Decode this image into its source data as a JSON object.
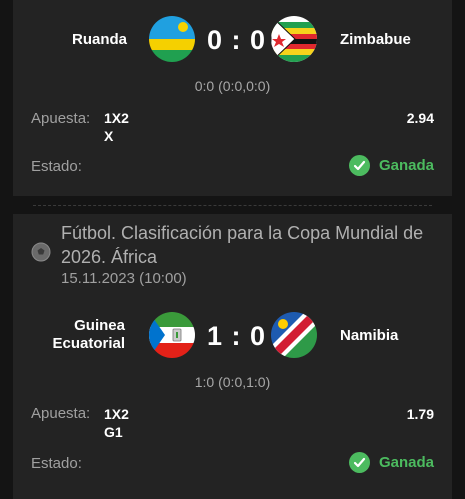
{
  "colors": {
    "accent_green": "#4cbb5f",
    "card_bg": "#232323",
    "page_bg": "#141414"
  },
  "match1": {
    "home": "Ruanda",
    "away": "Zimbabue",
    "score": "0 : 0",
    "subscore": "0:0 (0:0,0:0)",
    "bet_label": "Apuesta:",
    "market": "1X2",
    "selection": "X",
    "odds": "2.94",
    "status_label": "Estado:",
    "status": "Ganada",
    "home_flag_icon": "rwanda-flag-icon",
    "away_flag_icon": "zimbabwe-flag-icon"
  },
  "match2": {
    "league": "Fútbol. Clasificación para la Copa Mundial de 2026. África",
    "date": "15.11.2023 (10:00)",
    "home_line1": "Guinea",
    "home_line2": "Ecuatorial",
    "away": "Namibia",
    "score": "1 : 0",
    "subscore": "1:0 (0:0,1:0)",
    "bet_label": "Apuesta:",
    "market": "1X2",
    "selection": "G1",
    "odds": "1.79",
    "status_label": "Estado:",
    "status": "Ganada",
    "sport_icon": "soccer-ball-icon",
    "home_flag_icon": "equatorial-guinea-flag-icon",
    "away_flag_icon": "namibia-flag-icon"
  }
}
